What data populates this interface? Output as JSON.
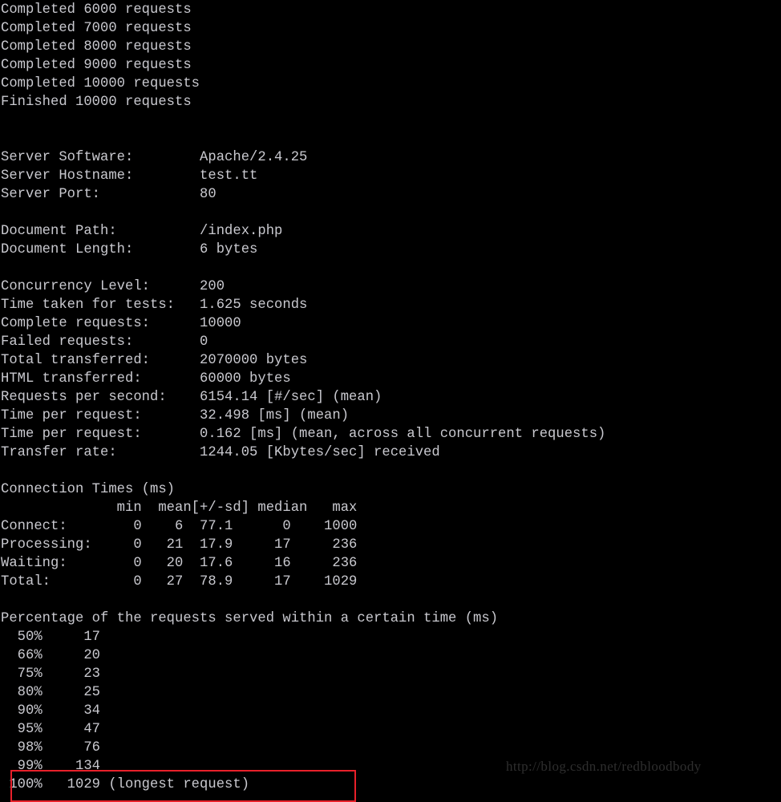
{
  "terminal": {
    "background_color": "#000000",
    "text_color": "#c9c9cf",
    "progress_lines": [
      "Completed 6000 requests",
      "Completed 7000 requests",
      "Completed 8000 requests",
      "Completed 9000 requests",
      "Completed 10000 requests",
      "Finished 10000 requests"
    ],
    "blank_1": "",
    "blank_2": "",
    "server_info": [
      {
        "label": "Server Software:",
        "value": "Apache/2.4.25",
        "line": "Server Software:        Apache/2.4.25"
      },
      {
        "label": "Server Hostname:",
        "value": "test.tt",
        "line": "Server Hostname:        test.tt"
      },
      {
        "label": "Server Port:",
        "value": "80",
        "line": "Server Port:            80"
      }
    ],
    "blank_3": "",
    "document_info": [
      {
        "label": "Document Path:",
        "value": "/index.php",
        "line": "Document Path:          /index.php"
      },
      {
        "label": "Document Length:",
        "value": "6 bytes",
        "line": "Document Length:        6 bytes"
      }
    ],
    "blank_4": "",
    "summary": [
      {
        "label": "Concurrency Level:",
        "value": "200",
        "line": "Concurrency Level:      200"
      },
      {
        "label": "Time taken for tests:",
        "value": "1.625 seconds",
        "line": "Time taken for tests:   1.625 seconds"
      },
      {
        "label": "Complete requests:",
        "value": "10000",
        "line": "Complete requests:      10000"
      },
      {
        "label": "Failed requests:",
        "value": "0",
        "line": "Failed requests:        0"
      },
      {
        "label": "Total transferred:",
        "value": "2070000 bytes",
        "line": "Total transferred:      2070000 bytes"
      },
      {
        "label": "HTML transferred:",
        "value": "60000 bytes",
        "line": "HTML transferred:       60000 bytes"
      },
      {
        "label": "Requests per second:",
        "value": "6154.14 [#/sec] (mean)",
        "line": "Requests per second:    6154.14 [#/sec] (mean)"
      },
      {
        "label": "Time per request:",
        "value": "32.498 [ms] (mean)",
        "line": "Time per request:       32.498 [ms] (mean)"
      },
      {
        "label": "Time per request:",
        "value": "0.162 [ms] (mean, across all concurrent requests)",
        "line": "Time per request:       0.162 [ms] (mean, across all concurrent requests)"
      },
      {
        "label": "Transfer rate:",
        "value": "1244.05 [Kbytes/sec] received",
        "line": "Transfer rate:          1244.05 [Kbytes/sec] received"
      }
    ],
    "blank_5": "",
    "connection_times": {
      "title": "Connection Times (ms)",
      "header_line": "              min  mean[+/-sd] median   max",
      "columns": [
        "",
        "min",
        "mean[+/-sd]",
        "median",
        "max"
      ],
      "rows": [
        {
          "label": "Connect:",
          "min": "0",
          "mean": "6",
          "sd": "77.1",
          "median": "0",
          "max": "1000",
          "line": "Connect:        0    6  77.1      0    1000"
        },
        {
          "label": "Processing:",
          "min": "0",
          "mean": "21",
          "sd": "17.9",
          "median": "17",
          "max": "236",
          "line": "Processing:     0   21  17.9     17     236"
        },
        {
          "label": "Waiting:",
          "min": "0",
          "mean": "20",
          "sd": "17.6",
          "median": "16",
          "max": "236",
          "line": "Waiting:        0   20  17.6     16     236"
        },
        {
          "label": "Total:",
          "min": "0",
          "mean": "27",
          "sd": "78.9",
          "median": "17",
          "max": "1029",
          "line": "Total:          0   27  78.9     17    1029"
        }
      ]
    },
    "blank_6": "",
    "percentiles": {
      "title": "Percentage of the requests served within a certain time (ms)",
      "rows": [
        {
          "percent": "50%",
          "value": "17",
          "note": "",
          "line": "  50%     17"
        },
        {
          "percent": "66%",
          "value": "20",
          "note": "",
          "line": "  66%     20"
        },
        {
          "percent": "75%",
          "value": "23",
          "note": "",
          "line": "  75%     23"
        },
        {
          "percent": "80%",
          "value": "25",
          "note": "",
          "line": "  80%     25"
        },
        {
          "percent": "90%",
          "value": "34",
          "note": "",
          "line": "  90%     34"
        },
        {
          "percent": "95%",
          "value": "47",
          "note": "",
          "line": "  95%     47"
        },
        {
          "percent": "98%",
          "value": "76",
          "note": "",
          "line": "  98%     76"
        },
        {
          "percent": "99%",
          "value": "134",
          "note": "",
          "line": "  99%    134"
        },
        {
          "percent": "100%",
          "value": "1029",
          "note": "(longest request)",
          "line": " 100%   1029 (longest request)"
        }
      ]
    }
  },
  "annotation": {
    "highlight_color": "#e8202a",
    "highlight_target": " 100%   1029 (longest request)"
  },
  "watermark": {
    "text": "http://blog.csdn.net/redbloodbody",
    "color": "#2e2e2e"
  }
}
